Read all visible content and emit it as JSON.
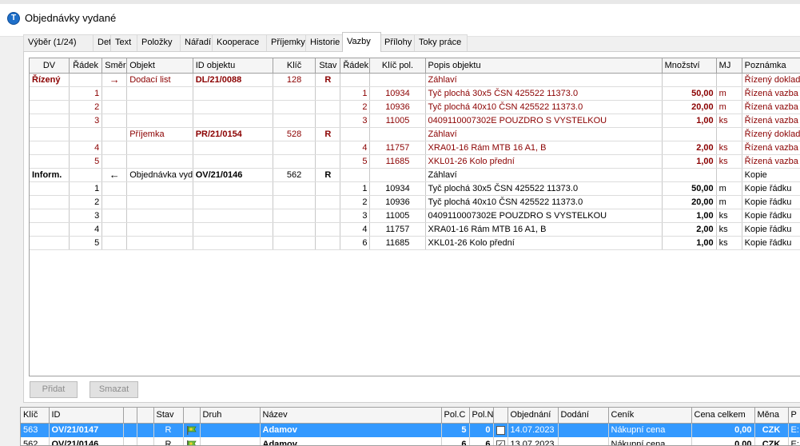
{
  "window": {
    "title": "Objednávky vydané",
    "icon": "app-logo-icon"
  },
  "tabs": [
    {
      "label": "Výběr (1/24)"
    },
    {
      "label": "Detail"
    },
    {
      "label": "Text"
    },
    {
      "label": "Položky"
    },
    {
      "label": "Nářadí"
    },
    {
      "label": "Kooperace"
    },
    {
      "label": "Příjemky"
    },
    {
      "label": "Historie"
    },
    {
      "label": "Vazby",
      "active": true
    },
    {
      "label": "Přílohy"
    },
    {
      "label": "Toky práce"
    }
  ],
  "grid": {
    "headers": [
      "DV",
      "Řádek",
      "Směr",
      "Objekt",
      "ID objektu",
      "Klíč",
      "Stav",
      "Řádek",
      "Klíč pol.",
      "Popis objektu",
      "Množství",
      "MJ",
      "Poznámka"
    ],
    "rows": [
      {
        "dv": "Řízený",
        "radek": "",
        "smer": "→",
        "objekt": "Dodací list",
        "id": "DL/21/0088",
        "klic": "128",
        "stav": "R",
        "radek2": "",
        "klicpol": "",
        "popis": "Záhlaví",
        "mnozstvi": "",
        "mj": "",
        "pozn": "Řízený doklad",
        "color": "red"
      },
      {
        "dv": "",
        "radek": "1",
        "smer": "",
        "objekt": "",
        "id": "",
        "klic": "",
        "stav": "",
        "radek2": "1",
        "klicpol": "10934",
        "popis": "Tyč plochá 30x5 ČSN 425522 11373.0",
        "mnozstvi": "50,00",
        "mj": "m",
        "pozn": "Řízená vazba",
        "color": "red"
      },
      {
        "dv": "",
        "radek": "2",
        "smer": "",
        "objekt": "",
        "id": "",
        "klic": "",
        "stav": "",
        "radek2": "2",
        "klicpol": "10936",
        "popis": "Tyč plochá 40x10 ČSN 425522 11373.0",
        "mnozstvi": "20,00",
        "mj": "m",
        "pozn": "Řízená vazba",
        "color": "red"
      },
      {
        "dv": "",
        "radek": "3",
        "smer": "",
        "objekt": "",
        "id": "",
        "klic": "",
        "stav": "",
        "radek2": "3",
        "klicpol": "11005",
        "popis": "0409110007302E POUZDRO S VYSTELKOU",
        "mnozstvi": "1,00",
        "mj": "ks",
        "pozn": "Řízená vazba",
        "color": "red"
      },
      {
        "dv": "",
        "radek": "",
        "smer": "",
        "objekt": "Příjemka",
        "id": "PR/21/0154",
        "klic": "528",
        "stav": "R",
        "radek2": "",
        "klicpol": "",
        "popis": "Záhlaví",
        "mnozstvi": "",
        "mj": "",
        "pozn": "Řízený doklad",
        "color": "red"
      },
      {
        "dv": "",
        "radek": "4",
        "smer": "",
        "objekt": "",
        "id": "",
        "klic": "",
        "stav": "",
        "radek2": "4",
        "klicpol": "11757",
        "popis": "XRA01-16 Rám MTB 16 A1, B",
        "mnozstvi": "2,00",
        "mj": "ks",
        "pozn": "Řízená vazba",
        "color": "red"
      },
      {
        "dv": "",
        "radek": "5",
        "smer": "",
        "objekt": "",
        "id": "",
        "klic": "",
        "stav": "",
        "radek2": "5",
        "klicpol": "11685",
        "popis": "XKL01-26 Kolo přední",
        "mnozstvi": "1,00",
        "mj": "ks",
        "pozn": "Řízená vazba",
        "color": "red"
      },
      {
        "dv": "Inform.",
        "radek": "",
        "smer": "←",
        "objekt": "Objednávka vyd",
        "id": "OV/21/0146",
        "klic": "562",
        "stav": "R",
        "radek2": "",
        "klicpol": "",
        "popis": "Záhlaví",
        "mnozstvi": "",
        "mj": "",
        "pozn": "Kopie",
        "color": "black"
      },
      {
        "dv": "",
        "radek": "1",
        "smer": "",
        "objekt": "",
        "id": "",
        "klic": "",
        "stav": "",
        "radek2": "1",
        "klicpol": "10934",
        "popis": "Tyč plochá 30x5 ČSN 425522 11373.0",
        "mnozstvi": "50,00",
        "mj": "m",
        "pozn": "Kopie řádku",
        "color": "black"
      },
      {
        "dv": "",
        "radek": "2",
        "smer": "",
        "objekt": "",
        "id": "",
        "klic": "",
        "stav": "",
        "radek2": "2",
        "klicpol": "10936",
        "popis": "Tyč plochá 40x10 ČSN 425522 11373.0",
        "mnozstvi": "20,00",
        "mj": "m",
        "pozn": "Kopie řádku",
        "color": "black"
      },
      {
        "dv": "",
        "radek": "3",
        "smer": "",
        "objekt": "",
        "id": "",
        "klic": "",
        "stav": "",
        "radek2": "3",
        "klicpol": "11005",
        "popis": "0409110007302E POUZDRO S VYSTELKOU",
        "mnozstvi": "1,00",
        "mj": "ks",
        "pozn": "Kopie řádku",
        "color": "black"
      },
      {
        "dv": "",
        "radek": "4",
        "smer": "",
        "objekt": "",
        "id": "",
        "klic": "",
        "stav": "",
        "radek2": "4",
        "klicpol": "11757",
        "popis": "XRA01-16 Rám MTB 16 A1, B",
        "mnozstvi": "2,00",
        "mj": "ks",
        "pozn": "Kopie řádku",
        "color": "black"
      },
      {
        "dv": "",
        "radek": "5",
        "smer": "",
        "objekt": "",
        "id": "",
        "klic": "",
        "stav": "",
        "radek2": "6",
        "klicpol": "11685",
        "popis": "XKL01-26 Kolo přední",
        "mnozstvi": "1,00",
        "mj": "ks",
        "pozn": "Kopie řádku",
        "color": "black"
      }
    ]
  },
  "buttons": {
    "add": "Přidat",
    "delete": "Smazat"
  },
  "list": {
    "headers": [
      "Klíč",
      "ID",
      "",
      "",
      "Stav",
      "",
      "Druh",
      "Název",
      "Pol.C",
      "Pol.N",
      "",
      "Objednání",
      "Dodání",
      "Ceník",
      "Cena celkem",
      "Měna",
      "P"
    ],
    "rows": [
      {
        "klic": "563",
        "id": "OV/21/0147",
        "stav": "R",
        "druh": "",
        "nazev": "Adamov",
        "polc": "5",
        "poln": "0",
        "checked": false,
        "objednani": "14.07.2023",
        "dodani": "",
        "cenik": "Nákupní cena",
        "cena": "0,00",
        "mena": "CZK",
        "p": "E:",
        "selected": true
      },
      {
        "klic": "562",
        "id": "OV/21/0146",
        "stav": "R",
        "druh": "",
        "nazev": "Adamov",
        "polc": "6",
        "poln": "6",
        "checked": true,
        "objednani": "13.07.2023",
        "dodani": "",
        "cenik": "Nákupní cena",
        "cena": "0,00",
        "mena": "CZK",
        "p": "E:",
        "selected": false
      }
    ]
  },
  "colors": {
    "detail_red": "#8b0000",
    "selection": "#3399ff"
  }
}
